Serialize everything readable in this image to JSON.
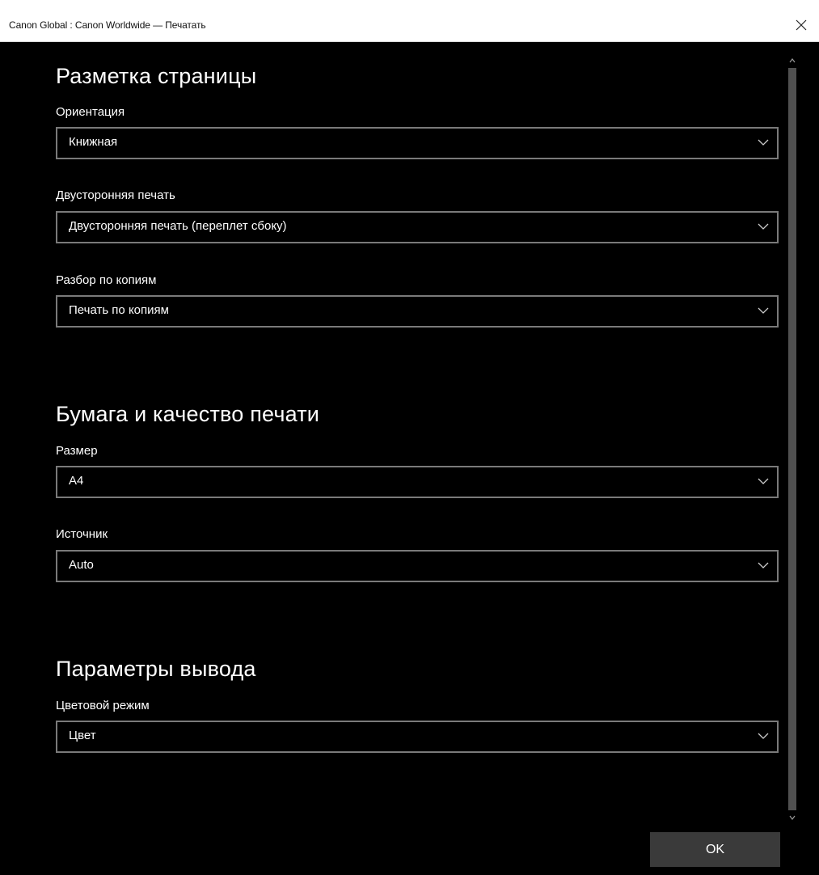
{
  "window": {
    "title": "Canon Global : Canon Worldwide — Печатать"
  },
  "sections": {
    "page_layout": {
      "title": "Разметка страницы",
      "orientation": {
        "label": "Ориентация",
        "value": "Книжная"
      },
      "duplex": {
        "label": "Двусторонняя печать",
        "value": "Двусторонняя печать (переплет сбоку)"
      },
      "collation": {
        "label": "Разбор по копиям",
        "value": "Печать по копиям"
      }
    },
    "paper_quality": {
      "title": "Бумага и качество печати",
      "size": {
        "label": "Размер",
        "value": "A4"
      },
      "source": {
        "label": "Источник",
        "value": "Auto"
      }
    },
    "output": {
      "title": "Параметры вывода",
      "color_mode": {
        "label": "Цветовой режим",
        "value": "Цвет"
      }
    }
  },
  "buttons": {
    "ok": "OK"
  },
  "icons": {
    "close": "close-icon",
    "dropdown": "chevron-down-icon",
    "scroll_up": "scroll-up-arrow-icon",
    "scroll_down": "scroll-down-arrow-icon"
  },
  "colors": {
    "background": "#000000",
    "text": "#ffffff",
    "field_border": "#7a7a7a",
    "button": "#3a3a3a",
    "titlebar": "#ffffff"
  }
}
